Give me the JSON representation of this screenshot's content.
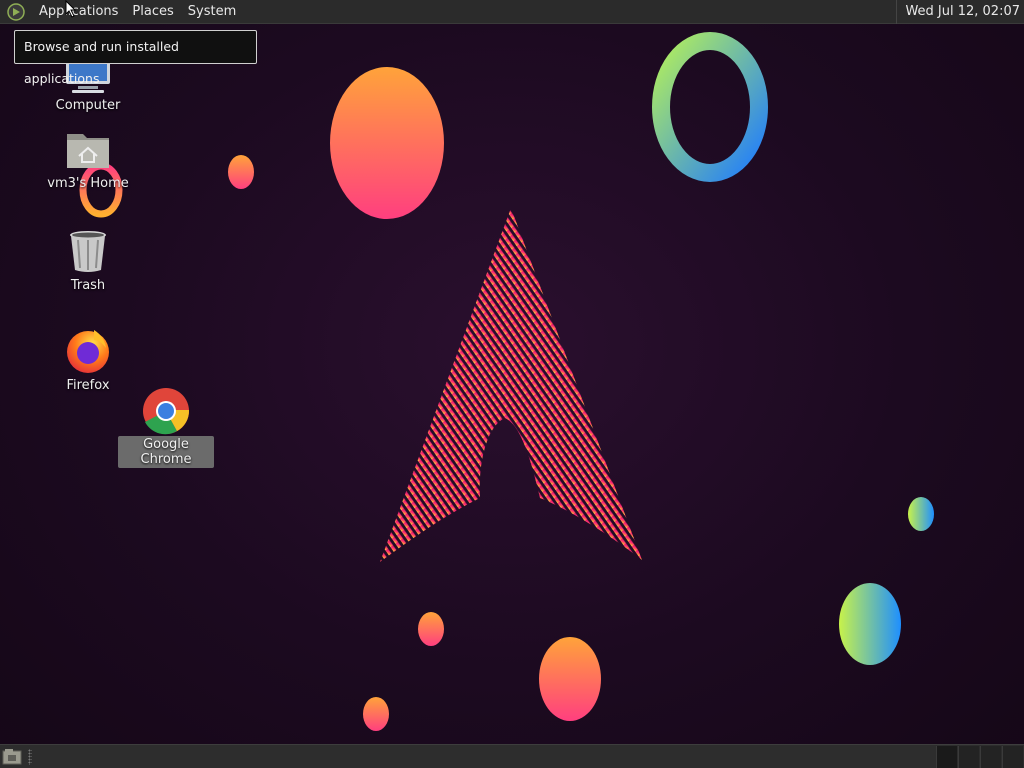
{
  "panel": {
    "menus": [
      "Applications",
      "Places",
      "System"
    ],
    "clock": "Wed Jul 12, 02:07"
  },
  "tooltip": "Browse and run installed applications",
  "desktop_icons": [
    {
      "label": "Computer",
      "icon": "computer-icon"
    },
    {
      "label": "vm3's Home",
      "icon": "home-folder-icon"
    },
    {
      "label": "Trash",
      "icon": "trash-icon"
    },
    {
      "label": "Firefox",
      "icon": "firefox-icon"
    },
    {
      "label": "Google Chrome",
      "icon": "chrome-icon",
      "selected": true
    }
  ],
  "taskbar": {
    "show_desktop_icon": "show-desktop-icon",
    "workspaces": 4
  },
  "colors": {
    "panel": "#2b2b2b",
    "desktop_bg": "#1c0a20",
    "arch_pink": "#e0206e",
    "arch_yellow": "#f5d842"
  }
}
